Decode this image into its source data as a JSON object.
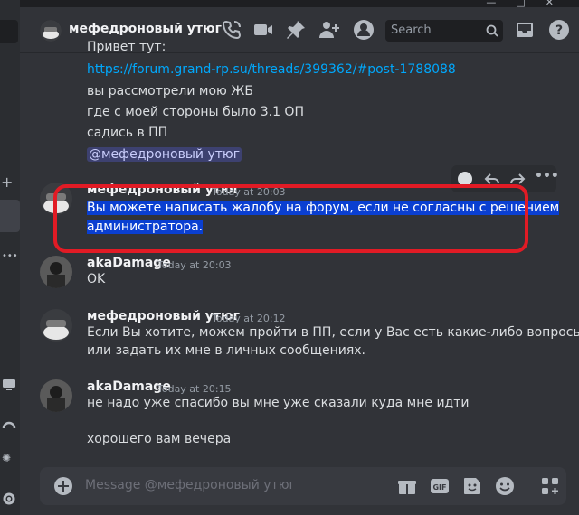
{
  "window": {
    "controls": [
      "—",
      "□",
      "✕"
    ]
  },
  "header": {
    "title": "мефедроновый утюг",
    "search_placeholder": "Search"
  },
  "messages": [
    {
      "kind": "continuation",
      "lines": [
        "Привет тут:",
        "https://forum.grand-rp.su/threads/399362/#post-1788088",
        "вы рассмотрели мою ЖБ",
        "где с моей стороны было 3.1 ОП",
        "садись в ПП"
      ],
      "mention": "@мефедроновый утюг"
    },
    {
      "kind": "group",
      "author": "мефедроновый утюг",
      "time": "Today at 20:03",
      "lines": [
        "Вы можете написать жалобу на форум, если не согласны с решением",
        "администратора."
      ],
      "highlighted": true
    },
    {
      "kind": "group",
      "author": "akaDamage",
      "time": "Today at 20:03",
      "lines": [
        "OK"
      ]
    },
    {
      "kind": "group",
      "author": "мефедроновый утюг",
      "time": "Today at 20:12",
      "lines": [
        "Если Вы хотите, можем пройти в ПП, если у Вас есть какие-либо вопросы",
        "или задать их мне в личных сообщениях."
      ]
    },
    {
      "kind": "group",
      "author": "akaDamage",
      "time": "Today at 20:15",
      "lines": [
        "не надо уже спасибо вы мне уже сказали куда мне идти",
        "хорошего вам вечера"
      ]
    }
  ],
  "composer": {
    "placeholder": "Message @мефедроновый утюг"
  },
  "colors": {
    "background": "#313338",
    "link": "#00a8fc",
    "selection": "#0a3fd1",
    "annotation": "#e11b25"
  }
}
